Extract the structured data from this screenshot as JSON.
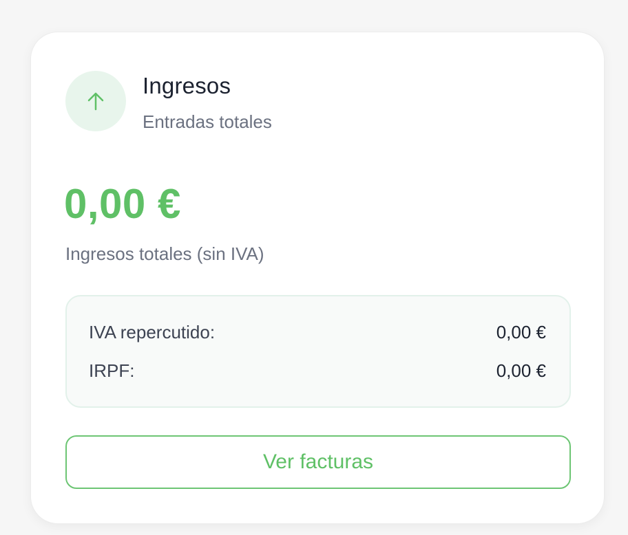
{
  "card": {
    "icon": "arrow-up-icon",
    "title": "Ingresos",
    "subtitle": "Entradas totales",
    "amount": "0,00 €",
    "amount_label": "Ingresos totales (sin IVA)",
    "breakdown": [
      {
        "label": "IVA repercutido:",
        "value": "0,00 €"
      },
      {
        "label": "IRPF:",
        "value": "0,00 €"
      }
    ],
    "button_label": "Ver facturas"
  },
  "colors": {
    "accent": "#5fc066",
    "icon_bg": "#e8f5ec",
    "title": "#1c2230",
    "muted": "#6b7180",
    "page_bg": "#f6f6f6"
  }
}
